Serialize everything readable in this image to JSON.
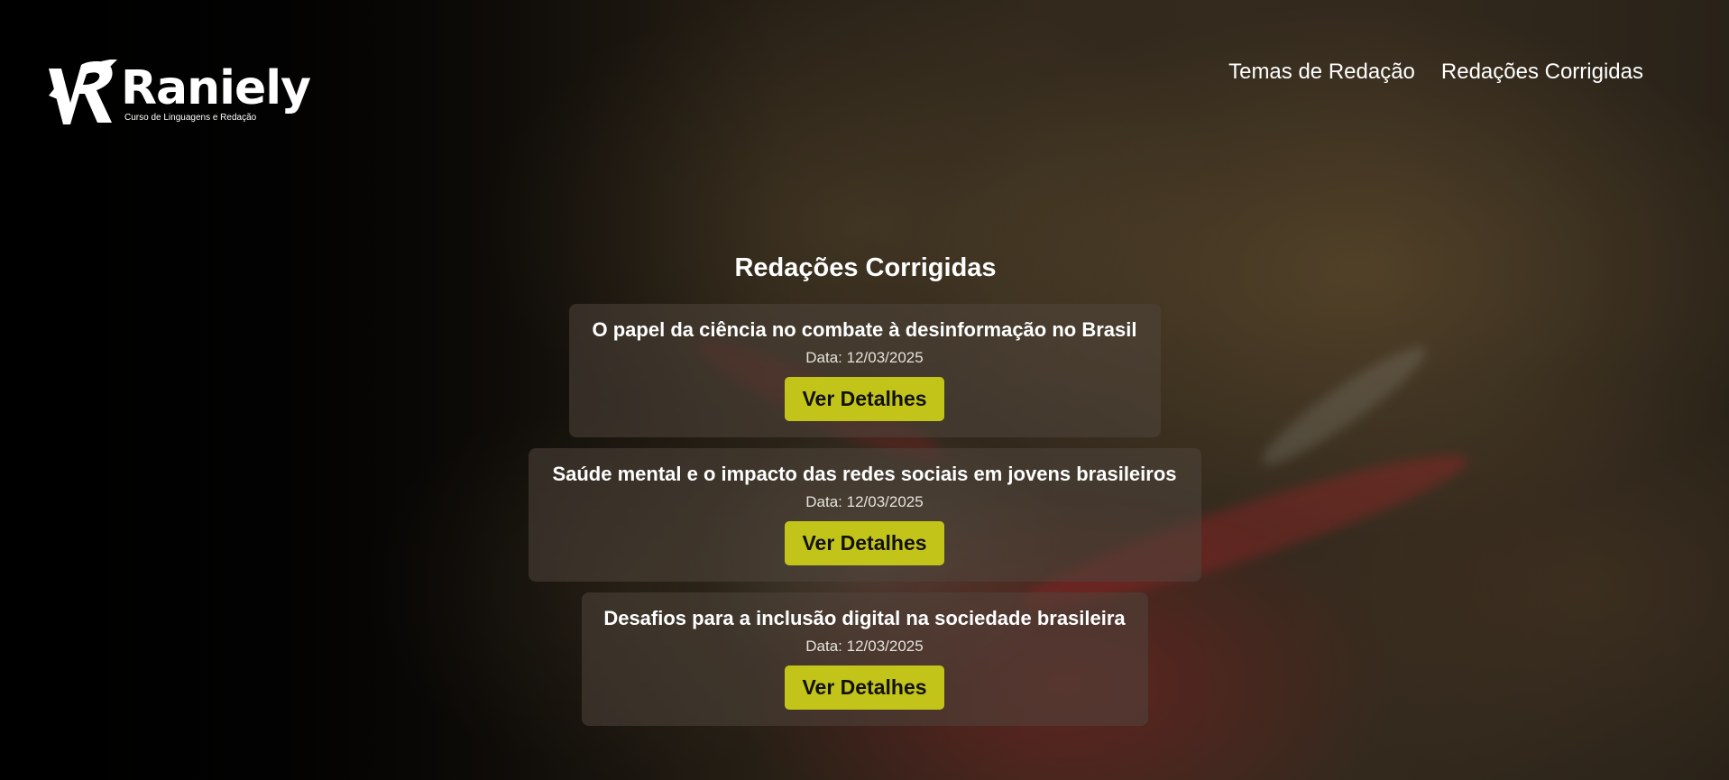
{
  "brand": {
    "name": "Raniely",
    "tagline": "Curso de Linguagens e Redação"
  },
  "nav": {
    "items": [
      {
        "label": "Temas de Redação"
      },
      {
        "label": "Redações Corrigidas"
      }
    ]
  },
  "page": {
    "title": "Redações Corrigidas"
  },
  "essays": [
    {
      "title": "O papel da ciência no combate à desinformação no Brasil",
      "date": "Data: 12/03/2025",
      "button_label": "Ver Detalhes"
    },
    {
      "title": "Saúde mental e o impacto das redes sociais em jovens brasileiros",
      "date": "Data: 12/03/2025",
      "button_label": "Ver Detalhes"
    },
    {
      "title": "Desafios para a inclusão digital na sociedade brasileira",
      "date": "Data: 12/03/2025",
      "button_label": "Ver Detalhes"
    }
  ],
  "colors": {
    "button_bg": "#c3c41a",
    "button_text": "#111111",
    "text": "#ffffff"
  },
  "icons": {
    "logo": "vr-monogram-icon"
  }
}
